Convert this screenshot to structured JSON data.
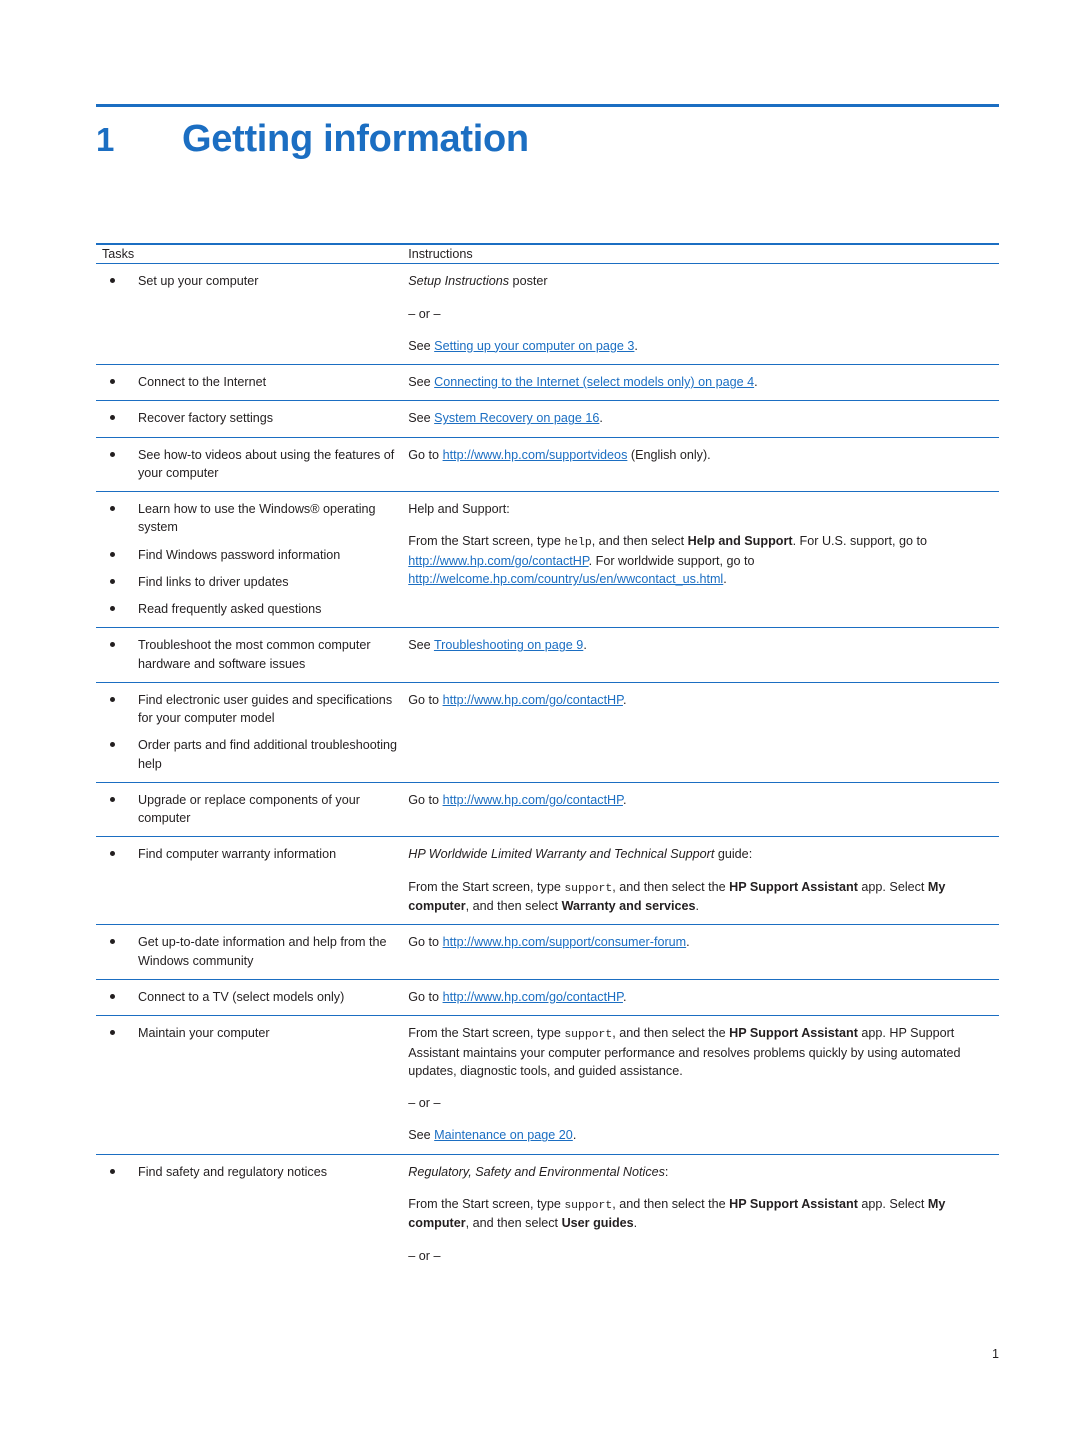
{
  "chapter": {
    "number": "1",
    "title": "Getting information"
  },
  "table": {
    "headers": {
      "tasks": "Tasks",
      "instructions": "Instructions"
    },
    "rows": [
      {
        "tasks": [
          "Set up your computer"
        ],
        "instructions_html": "<div class=\"p\"><span class=\"ital\">Setup Instructions</span> poster</div><div class=\"p\">– or –</div><div class=\"p\">See <span class=\"link\">Setting up your computer on page 3</span>.</div>"
      },
      {
        "tasks": [
          "Connect to the Internet"
        ],
        "instructions_html": "<div class=\"p\">See <span class=\"link\">Connecting to the Internet (select models only) on page 4</span>.</div>"
      },
      {
        "tasks": [
          "Recover factory settings"
        ],
        "instructions_html": "<div class=\"p\">See <span class=\"link\">System Recovery on page 16</span>.</div>"
      },
      {
        "tasks": [
          "See how-to videos about using the features of your computer"
        ],
        "instructions_html": "<div class=\"p\">Go to <span class=\"link\">http://www.hp.com/supportvideos</span> (English only).</div>"
      },
      {
        "tasks": [
          "Learn how to use the Windows® operating system",
          "Find Windows password information",
          "Find links to driver updates",
          "Read frequently asked questions"
        ],
        "instructions_html": "<div class=\"p\">Help and Support:</div><div class=\"p\">From the Start screen, type <span class=\"mono\">help</span>, and then select <span class=\"bold\">Help and Support</span>. For U.S. support, go to <span class=\"link\">http://www.hp.com/go/contactHP</span>. For worldwide support, go to <span class=\"link\">http://welcome.hp.com/country/us/en/wwcontact_us.html</span>.</div>"
      },
      {
        "tasks": [
          "Troubleshoot the most common computer hardware and software issues"
        ],
        "instructions_html": "<div class=\"p\">See <span class=\"link\">Troubleshooting on page 9</span>.</div>"
      },
      {
        "tasks": [
          "Find electronic user guides and specifications for your computer model",
          "Order parts and find additional troubleshooting help"
        ],
        "instructions_html": "<div class=\"p\">Go to <span class=\"link\">http://www.hp.com/go/contactHP</span>.</div>"
      },
      {
        "tasks": [
          "Upgrade or replace components of your computer"
        ],
        "instructions_html": "<div class=\"p\">Go to <span class=\"link\">http://www.hp.com/go/contactHP</span>.</div>"
      },
      {
        "tasks": [
          "Find computer warranty information"
        ],
        "instructions_html": "<div class=\"p\"><span class=\"ital\">HP Worldwide Limited Warranty and Technical Support</span> guide:</div><div class=\"p\">From the Start screen, type <span class=\"mono\">support</span>, and then select the <span class=\"bold\">HP Support Assistant</span> app. Select <span class=\"bold\">My computer</span>, and then select <span class=\"bold\">Warranty and services</span>.</div>"
      },
      {
        "tasks": [
          "Get up-to-date information and help from the Windows community"
        ],
        "instructions_html": "<div class=\"p\">Go to <span class=\"link\">http://www.hp.com/support/consumer-forum</span>.</div>"
      },
      {
        "tasks": [
          "Connect to a TV (select models only)"
        ],
        "instructions_html": "<div class=\"p\">Go to <span class=\"link\">http://www.hp.com/go/contactHP</span>.</div>"
      },
      {
        "tasks": [
          "Maintain your computer"
        ],
        "instructions_html": "<div class=\"p\">From the Start screen, type <span class=\"mono\">support</span>, and then select the <span class=\"bold\">HP Support Assistant</span> app. HP Support Assistant maintains your computer performance and resolves problems quickly by using automated updates, diagnostic tools, and guided assistance.</div><div class=\"p\">– or –</div><div class=\"p\">See <span class=\"link\">Maintenance on page 20</span>.</div>"
      },
      {
        "tasks": [
          "Find safety and regulatory notices"
        ],
        "instructions_html": "<div class=\"p\"><span class=\"ital\">Regulatory, Safety and Environmental Notices</span>:</div><div class=\"p\">From the Start screen, type <span class=\"mono\">support</span>, and then select the <span class=\"bold\">HP Support Assistant</span> app. Select <span class=\"bold\">My computer</span>, and then select <span class=\"bold\">User guides</span>.</div><div class=\"p\">– or –</div>",
        "no_border": true
      }
    ]
  },
  "footer": {
    "page_number": "1"
  },
  "colors": {
    "accent": "#1b6ec2",
    "text": "#231f20"
  }
}
